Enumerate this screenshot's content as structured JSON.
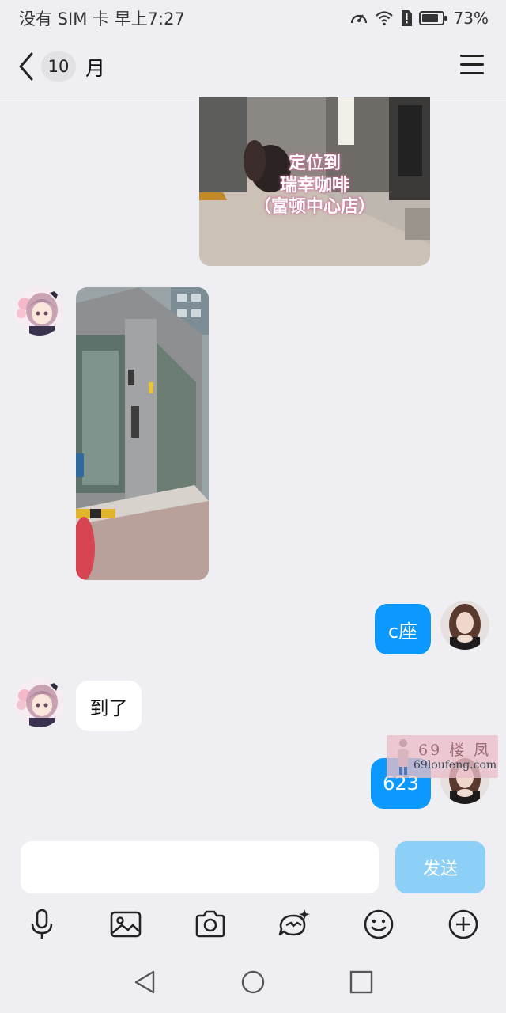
{
  "status_bar": {
    "carrier_time": "没有 SIM 卡 早上7:27",
    "battery": "73%"
  },
  "header": {
    "unread_count": "10",
    "title": "月"
  },
  "messages": [
    {
      "type": "image",
      "direction": "outgoing",
      "overlay_lines": [
        "定位到",
        "瑞幸咖啡",
        "（富顿中心店）"
      ]
    },
    {
      "type": "image",
      "direction": "incoming"
    },
    {
      "type": "text",
      "direction": "outgoing",
      "text": "c座"
    },
    {
      "type": "text",
      "direction": "incoming",
      "text": "到了"
    },
    {
      "type": "text",
      "direction": "outgoing",
      "text": "623"
    }
  ],
  "watermark": {
    "line1": "69 楼 凤",
    "line2": "69loufeng.com"
  },
  "composer": {
    "placeholder": "",
    "send_label": "发送"
  },
  "toolbar": {
    "icons": [
      "microphone-icon",
      "image-icon",
      "camera-icon",
      "sticker-icon",
      "emoji-icon",
      "plus-icon"
    ]
  },
  "nav_bar": {
    "icons": [
      "back-triangle-icon",
      "home-circle-icon",
      "recents-square-icon"
    ]
  },
  "colors": {
    "outgoing_bubble": "#0c99ff",
    "incoming_bubble": "#ffffff",
    "send_button_disabled": "#8ccff7",
    "background": "#efeff3"
  }
}
